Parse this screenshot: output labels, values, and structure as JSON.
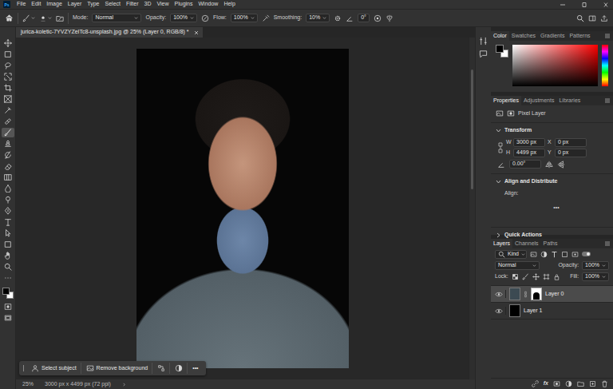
{
  "menu": {
    "logo": "Ps",
    "items": [
      "File",
      "Edit",
      "Image",
      "Layer",
      "Type",
      "Select",
      "Filter",
      "3D",
      "View",
      "Plugins",
      "Window",
      "Help"
    ]
  },
  "options_bar": {
    "mode_label": "Mode:",
    "mode": "Normal",
    "opacity_label": "Opacity:",
    "opacity": "100%",
    "flow_label": "Flow:",
    "flow": "100%",
    "smoothing_label": "Smoothing:",
    "smoothing": "10%",
    "angle": "0°"
  },
  "document": {
    "title": "jurica-koletic-7YVZYZeITc8-unsplash.jpg @ 25% (Layer 0, RGB/8) *"
  },
  "tools": [
    {
      "selected": false
    },
    {
      "selected": false
    },
    {
      "selected": false
    },
    {
      "selected": false
    },
    {
      "selected": false
    },
    {
      "selected": false
    },
    {
      "selected": false
    },
    {
      "selected": false
    },
    {
      "selected": true
    },
    {
      "selected": false
    },
    {
      "selected": false
    },
    {
      "selected": false
    },
    {
      "selected": false
    },
    {
      "selected": false
    },
    {
      "selected": false
    },
    {
      "selected": false
    },
    {
      "selected": false
    },
    {
      "selected": false
    },
    {
      "selected": false
    },
    {
      "selected": false
    },
    {
      "selected": false
    },
    {
      "selected": false
    }
  ],
  "context_bar": {
    "buttons": [
      "Select subject",
      "Remove background"
    ],
    "more": "•••"
  },
  "status_bar": {
    "zoom": "25%",
    "info": "3000 px x 4499 px (72 ppi)"
  },
  "color_panel": {
    "tabs": [
      {
        "label": "Color",
        "selected": true
      },
      {
        "label": "Swatches",
        "selected": false
      },
      {
        "label": "Gradients",
        "selected": false
      },
      {
        "label": "Patterns",
        "selected": false
      }
    ],
    "foreground": "#000000",
    "background": "#ffffff"
  },
  "properties_panel": {
    "tabs": [
      {
        "label": "Properties",
        "selected": true
      },
      {
        "label": "Adjustments",
        "selected": false
      },
      {
        "label": "Libraries",
        "selected": false
      }
    ],
    "layer_kind": "Pixel Layer",
    "transform": {
      "title": "Transform",
      "expanded": true,
      "w_label": "W",
      "w": "3000 px",
      "x_label": "X",
      "x": "0 px",
      "h_label": "H",
      "h": "4499 px",
      "y_label": "Y",
      "y": "0 px",
      "angle": "0.00°"
    },
    "align": {
      "title": "Align and Distribute",
      "expanded": true,
      "label": "Align:",
      "more": "•••"
    },
    "quick_actions": {
      "title": "Quick Actions",
      "expanded": false
    }
  },
  "layers_panel": {
    "tabs": [
      {
        "label": "Layers",
        "selected": true
      },
      {
        "label": "Channels",
        "selected": false
      },
      {
        "label": "Paths",
        "selected": false
      }
    ],
    "filter": "Kind",
    "blend_mode": "Normal",
    "opacity_label": "Opacity:",
    "opacity": "100%",
    "lock_label": "Lock:",
    "fill_label": "Fill:",
    "fill": "100%",
    "fx": "fx",
    "layers": [
      {
        "name": "Layer 0",
        "visible": true,
        "selected": true,
        "has_mask": true,
        "color": "#3c4a52"
      },
      {
        "name": "Layer 1",
        "visible": true,
        "selected": false,
        "has_mask": false,
        "color": "#000000"
      }
    ]
  }
}
